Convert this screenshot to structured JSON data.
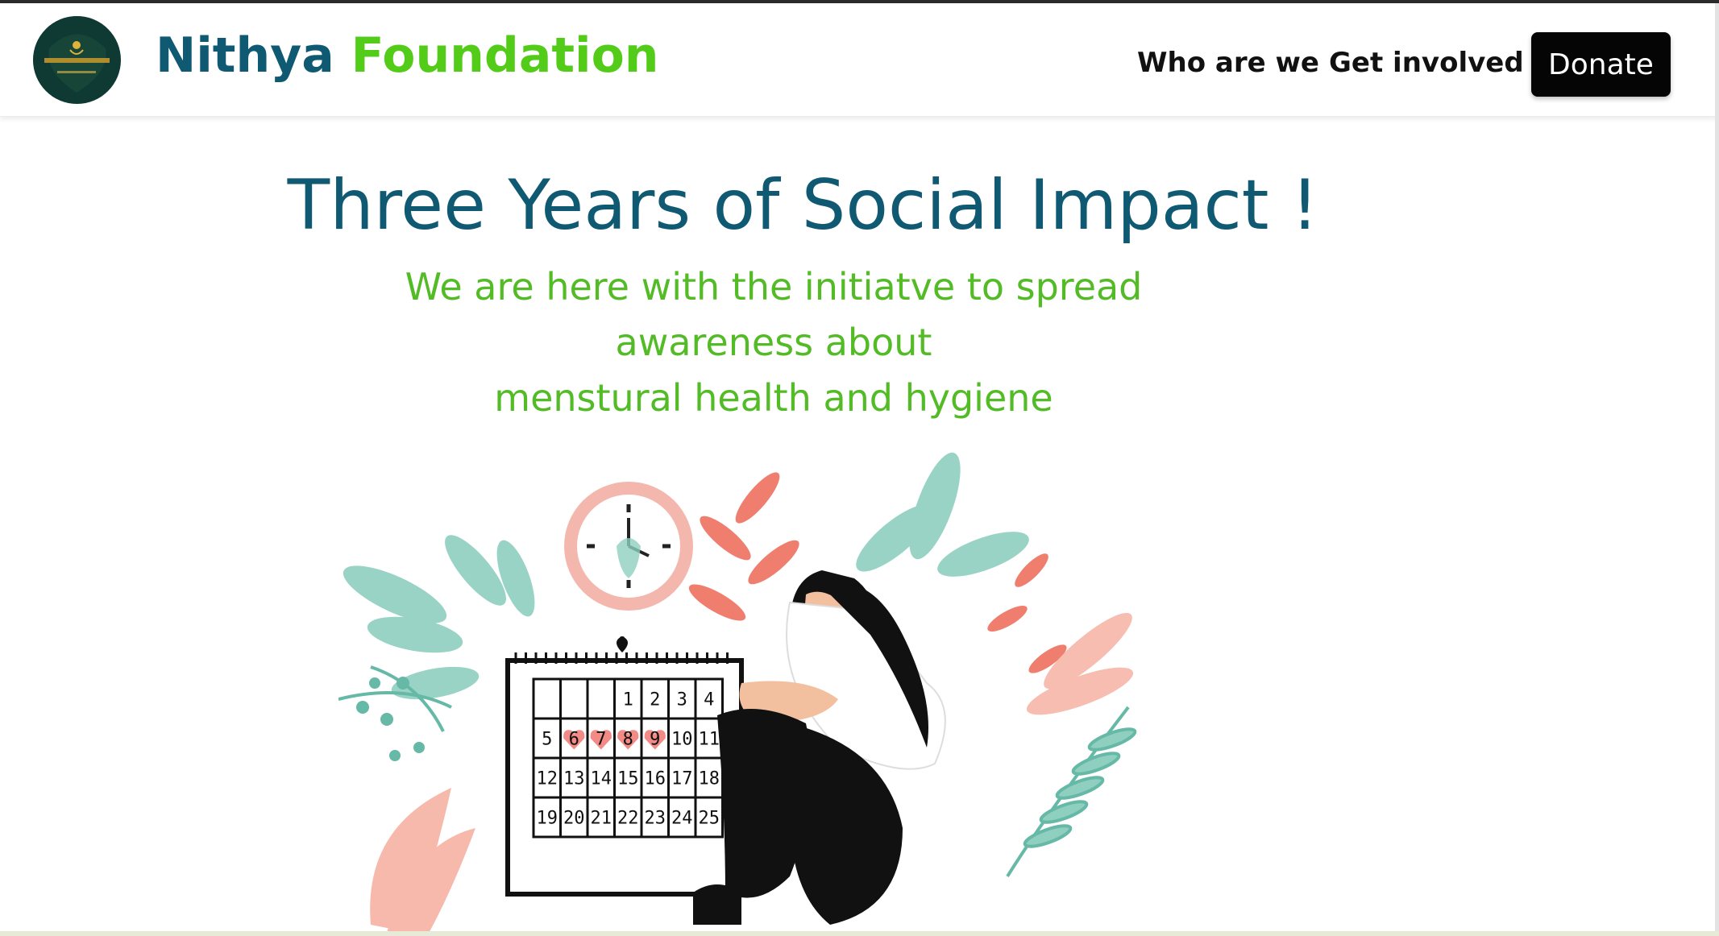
{
  "header": {
    "logo_icon": "nithya-foundation-logo",
    "logo_text": "NITHYA FOUNDATION",
    "brand_first": "Nithya",
    "brand_second": "Foundation",
    "nav": [
      {
        "label": "Who are we"
      },
      {
        "label": "Get involved"
      }
    ],
    "donate_label": "Donate"
  },
  "hero": {
    "title": "Three Years of Social Impact !",
    "subtitle_line1": "We are here with the initiatve to spread awareness about",
    "subtitle_line2": "menstural health and hygiene",
    "illustration_icon": "menstrual-calendar-illustration",
    "calendar_days": [
      "1",
      "2",
      "3",
      "4",
      "5",
      "6",
      "7",
      "8",
      "9",
      "10",
      "11",
      "12",
      "13",
      "14",
      "15",
      "16",
      "17",
      "18",
      "19",
      "20",
      "21",
      "22",
      "23",
      "24",
      "25"
    ]
  },
  "colors": {
    "brand_blue": "#0f5a72",
    "brand_green": "#52cc18",
    "subtitle_green": "#52bb25",
    "donate_bg": "#050505"
  }
}
